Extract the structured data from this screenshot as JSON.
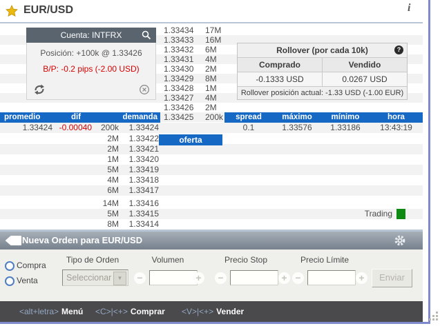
{
  "window": {
    "title": "EUR/USD"
  },
  "icons": {
    "info": "i",
    "help": "?",
    "minus": "−",
    "plus": "+",
    "dropdown": "▼"
  },
  "account": {
    "header": "Cuenta: INTFRX",
    "position": "Posición: +100k @ 1.33426",
    "pl": "B/P: -0.2 pips (-2.00 USD)"
  },
  "rollover": {
    "title": "Rollover (por cada 10k)",
    "columns": {
      "comprado": "Comprado",
      "vendido": "Vendido"
    },
    "values": {
      "comprado": "-0.1333 USD",
      "vendido": "0.0267 USD"
    },
    "note": "Rollover posición actual: -1.33 USD (-1.00 EUR)"
  },
  "ask": {
    "label": "oferta",
    "rows": [
      {
        "price": "1.33434",
        "size": "17M"
      },
      {
        "price": "1.33433",
        "size": "16M"
      },
      {
        "price": "1.33432",
        "size": "6M"
      },
      {
        "price": "1.33431",
        "size": "4M"
      },
      {
        "price": "1.33430",
        "size": "2M"
      },
      {
        "price": "1.33429",
        "size": "8M"
      },
      {
        "price": "1.33428",
        "size": "1M"
      },
      {
        "price": "1.33427",
        "size": "4M"
      },
      {
        "price": "1.33426",
        "size": "2M"
      },
      {
        "price": "1.33425",
        "size": "200k"
      }
    ]
  },
  "bid": {
    "headers": {
      "promedio": "promedio",
      "dif": "dif",
      "demanda": "demanda"
    },
    "promedio": "1.33424",
    "dif": "-0.00040",
    "top": {
      "size": "200k",
      "price": "1.33424"
    },
    "rows": [
      {
        "size": "2M",
        "price": "1.33422"
      },
      {
        "size": "2M",
        "price": "1.33421"
      },
      {
        "size": "1M",
        "price": "1.33420"
      },
      {
        "size": "5M",
        "price": "1.33419"
      },
      {
        "size": "4M",
        "price": "1.33418"
      },
      {
        "size": "6M",
        "price": "1.33417"
      },
      {
        "size": "14M",
        "price": "1.33416"
      },
      {
        "size": "5M",
        "price": "1.33415"
      },
      {
        "size": "8M",
        "price": "1.33414"
      }
    ]
  },
  "spread": {
    "headers": [
      "spread",
      "máximo",
      "mínimo",
      "hora"
    ],
    "values": [
      "0.1",
      "1.33576",
      "1.33186",
      "13:43:19"
    ]
  },
  "status": {
    "trading": "Trading"
  },
  "order": {
    "title": "Nueva Orden para EUR/USD",
    "compra": "Compra",
    "venta": "Venta",
    "tipo_label": "Tipo de Orden",
    "tipo_value": "Seleccionar",
    "volumen_label": "Volumen",
    "stop_label": "Precio Stop",
    "limite_label": "Precio Límite",
    "enviar": "Enviar"
  },
  "footer": {
    "items": [
      {
        "keys": "<alt+letra>",
        "label": "Menú"
      },
      {
        "keys": "<C>|<+>",
        "label": "Comprar"
      },
      {
        "keys": "<V>|<+>",
        "label": "Vender"
      }
    ]
  },
  "colors": {
    "accent_blue": "#1568c4",
    "negative_red": "#d40000",
    "trading_green": "#0e8a12",
    "window_border": "#7e8acd",
    "panel_slate": "#59646f"
  }
}
